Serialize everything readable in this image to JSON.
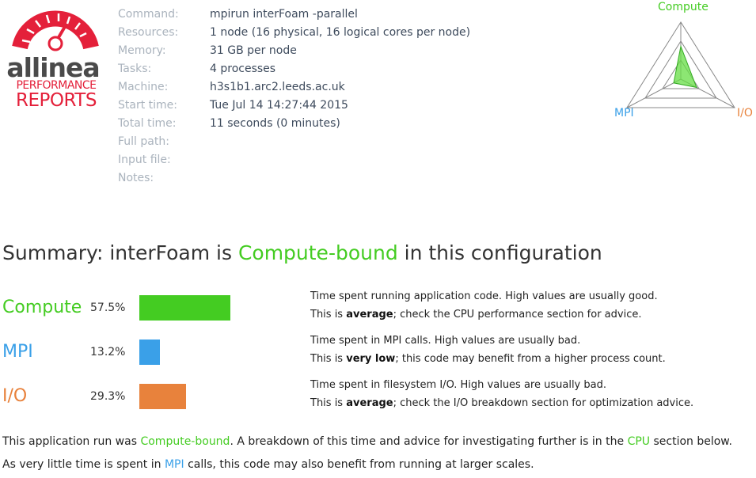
{
  "logo": {
    "main": "allinea",
    "sub1": "PERFORMANCE",
    "sub2": "REPORTS"
  },
  "info": [
    {
      "label": "Command:",
      "value": "mpirun interFoam -parallel"
    },
    {
      "label": "Resources:",
      "value": "1 node (16 physical, 16 logical cores per node)"
    },
    {
      "label": "Memory:",
      "value": "31 GB per node"
    },
    {
      "label": "Tasks:",
      "value": "4 processes"
    },
    {
      "label": "Machine:",
      "value": "h3s1b1.arc2.leeds.ac.uk"
    },
    {
      "label": "Start time:",
      "value": "Tue Jul 14 14:27:44 2015"
    },
    {
      "label": "Total time:",
      "value": "11 seconds (0 minutes)"
    },
    {
      "label": "Full path:",
      "value": ""
    },
    {
      "label": "Input file:",
      "value": ""
    },
    {
      "label": "Notes:",
      "value": ""
    }
  ],
  "radar": {
    "labels": {
      "compute": "Compute",
      "mpi": "MPI",
      "io": "I/O"
    },
    "values": {
      "compute": 57.5,
      "mpi": 13.2,
      "io": 29.3
    }
  },
  "summary": {
    "prefix": "Summary: interFoam is ",
    "highlight": "Compute-bound",
    "suffix": " in this configuration"
  },
  "metrics": [
    {
      "name": "Compute",
      "percent": "57.5%",
      "value": 57.5,
      "line1": "Time spent running application code. High values are usually good.",
      "line2_pre": "This is ",
      "line2_bold": "average",
      "line2_post": "; check the CPU performance section for advice."
    },
    {
      "name": "MPI",
      "percent": "13.2%",
      "value": 13.2,
      "line1": "Time spent in MPI calls. High values are usually bad.",
      "line2_pre": "This is ",
      "line2_bold": "very low",
      "line2_post": "; this code may benefit from a higher process count."
    },
    {
      "name": "I/O",
      "percent": "29.3%",
      "value": 29.3,
      "line1": "Time spent in filesystem I/O. High values are usually bad.",
      "line2_pre": "This is ",
      "line2_bold": "average",
      "line2_post": "; check the I/O breakdown section for optimization advice."
    }
  ],
  "footer": {
    "line1_a": "This application run was ",
    "line1_b": "Compute-bound",
    "line1_c": ". A breakdown of this time and advice for investigating further is in the ",
    "line1_d": "CPU",
    "line1_e": " section below.",
    "line2_a": "As very little time is spent in ",
    "line2_b": "MPI",
    "line2_c": " calls, this code may also benefit from running at larger scales."
  },
  "colors": {
    "compute": "#44cc22",
    "mpi": "#3aa0e8",
    "io": "#e8823c",
    "brand": "#e4203a"
  }
}
